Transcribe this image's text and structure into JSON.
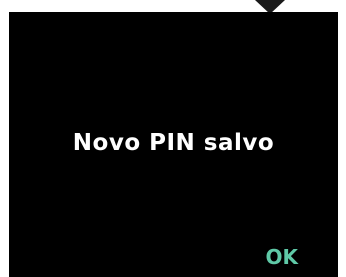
{
  "screen": {
    "message": "Novo PIN salvo",
    "ok_label": "OK"
  },
  "icons": {
    "pointer": "triangle-down-icon"
  },
  "colors": {
    "background": "#000000",
    "message_text": "#ffffff",
    "ok_accent": "#5fc9a7",
    "pointer": "#1a1a1a"
  }
}
